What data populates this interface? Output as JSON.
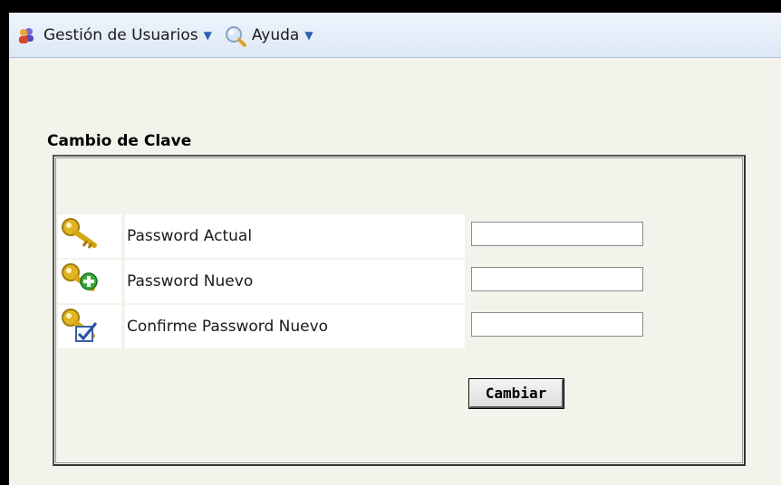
{
  "menu": {
    "items": [
      {
        "label": "Gestión de Usuarios",
        "icon": "users-icon"
      },
      {
        "label": "Ayuda",
        "icon": "magnifier-icon"
      }
    ]
  },
  "form": {
    "title": "Cambio de Clave",
    "rows": [
      {
        "label": "Password Actual",
        "icon": "key-icon",
        "value": ""
      },
      {
        "label": "Password Nuevo",
        "icon": "key-add-icon",
        "value": ""
      },
      {
        "label": "Confirme Password Nuevo",
        "icon": "key-check-icon",
        "value": ""
      }
    ],
    "submit_label": "Cambiar"
  },
  "colors": {
    "menubar": "#dde8f6",
    "background": "#f3f2eb",
    "caret": "#2b5fb4",
    "key": "#e0b521"
  }
}
